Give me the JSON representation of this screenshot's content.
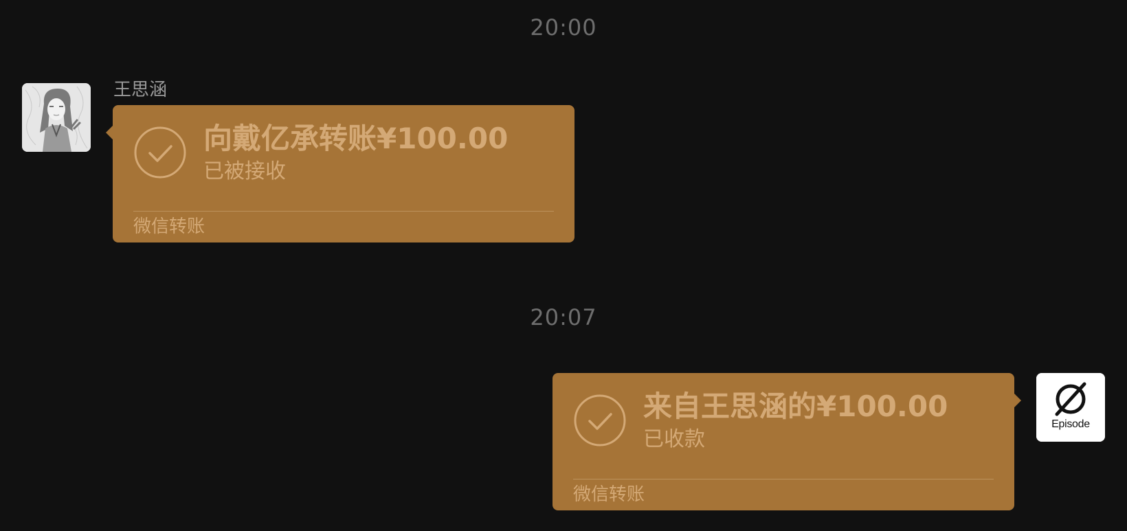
{
  "timestamps": {
    "first": "20:00",
    "second": "20:07"
  },
  "messages": [
    {
      "side": "left",
      "sender": "王思涵",
      "amount_title": "向戴亿承转账¥100.00",
      "status": "已被接收",
      "footer": "微信转账",
      "icon": "check-circle-icon",
      "avatar": "anime-girl-avatar"
    },
    {
      "side": "right",
      "amount_title": "来自王思涵的¥100.00",
      "status": "已收款",
      "footer": "微信转账",
      "icon": "check-circle-icon",
      "avatar": "episode-logo-avatar",
      "avatar_text": "Episode"
    }
  ],
  "colors": {
    "background": "#111111",
    "bubble": "#a67437",
    "bubble_text": "#d4a976",
    "timestamp": "#6e6e6e"
  }
}
